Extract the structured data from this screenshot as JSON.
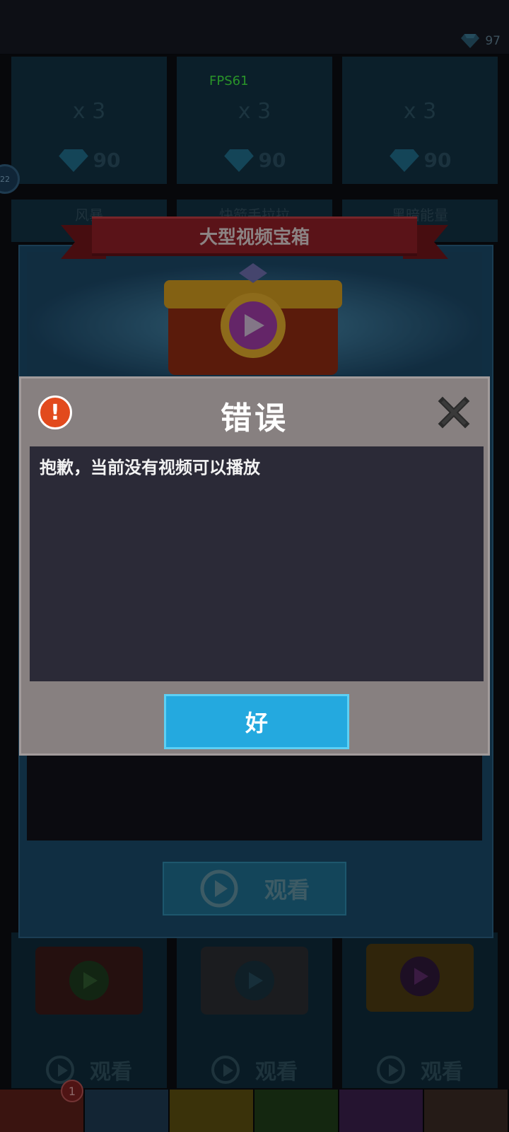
{
  "status": {
    "fps": "FPS61",
    "gems": "97",
    "level": "22"
  },
  "shop_cards": [
    {
      "qty": "x 3",
      "price": "90"
    },
    {
      "qty": "x 3",
      "price": "90"
    },
    {
      "qty": "x 3",
      "price": "90"
    }
  ],
  "shop_names": [
    "风暴",
    "快箭手拉拉",
    "黑暗能量"
  ],
  "chest_popup": {
    "title": "大型视频宝箱",
    "watch_label": "观看"
  },
  "bottom_chests": [
    {
      "watch_label": "观看"
    },
    {
      "watch_label": "观看"
    },
    {
      "watch_label": "观看"
    }
  ],
  "tabbar": {
    "badge": "1"
  },
  "error_dialog": {
    "title": "错误",
    "message": "抱歉，当前没有视频可以播放",
    "ok_label": "好"
  },
  "colors": {
    "error_icon": "#e24a1d",
    "ok_button": "#24a9df",
    "dialog_bg": "#878080",
    "message_bg": "#2b2a37"
  }
}
